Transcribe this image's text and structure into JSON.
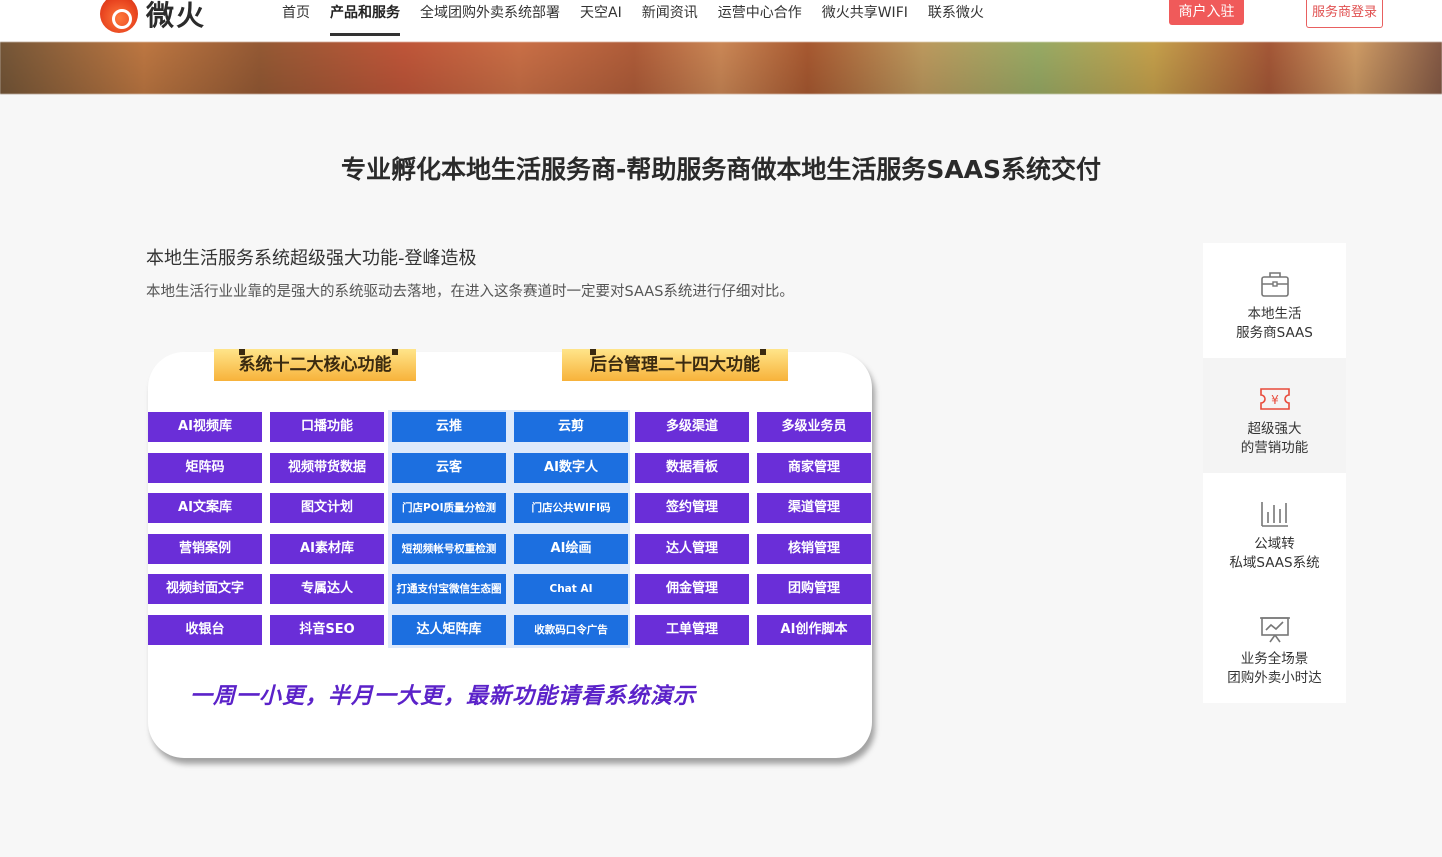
{
  "header": {
    "logo_text": "微火",
    "nav": [
      {
        "label": "首页",
        "active": false
      },
      {
        "label": "产品和服务",
        "active": true
      },
      {
        "label": "全域团购外卖系统部署",
        "active": false
      },
      {
        "label": "天空AI",
        "active": false
      },
      {
        "label": "新闻资讯",
        "active": false
      },
      {
        "label": "运营中心合作",
        "active": false
      },
      {
        "label": "微火共享WIFI",
        "active": false
      },
      {
        "label": "联系微火",
        "active": false
      }
    ],
    "merchant_button": "商户入驻",
    "provider_button": "服务商登录"
  },
  "main": {
    "title": "专业孵化本地生活服务商-帮助服务商做本地生活服务SAAS系统交付",
    "subtitle": "本地生活服务系统超级强大功能-登峰造极",
    "description": "本地生活行业业靠的是强大的系统驱动去落地，在进入这条赛道时一定要对SAAS系统进行仔细对比。"
  },
  "feature_card": {
    "ribbon_left": "系统十二大核心功能",
    "ribbon_right": "后台管理二十四大功能",
    "rows": [
      [
        "AI视频库",
        "口播功能",
        "云推",
        "云剪",
        "多级渠道",
        "多级业务员"
      ],
      [
        "矩阵码",
        "视频带货数据",
        "云客",
        "AI数字人",
        "数据看板",
        "商家管理"
      ],
      [
        "AI文案库",
        "图文计划",
        "门店POI质量分检测",
        "门店公共WIFI码",
        "签约管理",
        "渠道管理"
      ],
      [
        "营销案例",
        "AI素材库",
        "短视频帐号权重检测",
        "AI绘画",
        "达人管理",
        "核销管理"
      ],
      [
        "视频封面文字",
        "专属达人",
        "打通支付宝微信生态圈",
        "Chat AI",
        "佣金管理",
        "团购管理"
      ],
      [
        "收银台",
        "抖音SEO",
        "达人矩阵库",
        "收款码口令广告",
        "工单管理",
        "AI创作脚本"
      ]
    ],
    "slogan": "一周一小更，半月一大更，最新功能请看系统演示",
    "colors": {
      "purple": "#6a2ed8",
      "blue": "#1c6fe0",
      "ribbon": "#f7b23a"
    }
  },
  "side": [
    {
      "icon": "briefcase-icon",
      "line1": "本地生活",
      "line2": "服务商SAAS"
    },
    {
      "icon": "coupon-icon",
      "line1": "超级强大",
      "line2": "的营销功能"
    },
    {
      "icon": "bar-chart-icon",
      "line1": "公域转",
      "line2": "私域SAAS系统"
    },
    {
      "icon": "presentation-icon",
      "line1": "业务全场景",
      "line2": "团购外卖小时达"
    }
  ],
  "theme": {
    "accent": "#f05a5a",
    "coupon_red": "#e84a3a"
  }
}
